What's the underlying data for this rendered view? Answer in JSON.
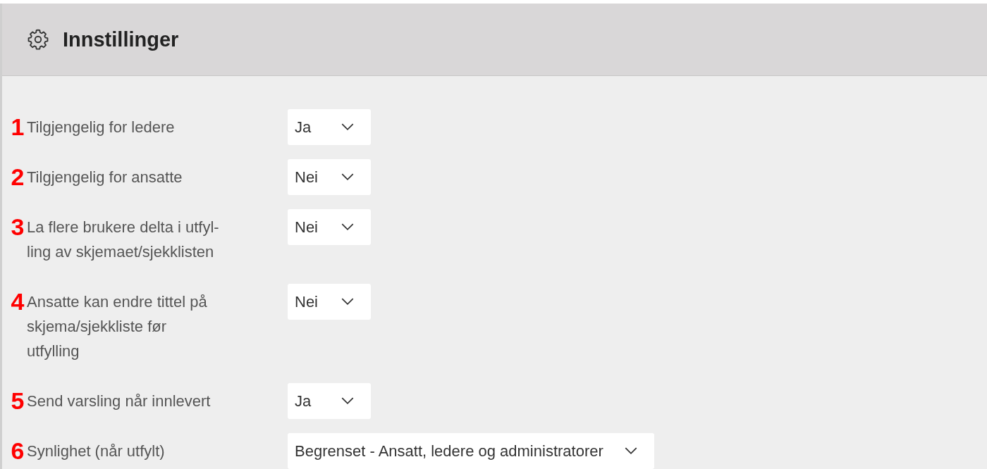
{
  "header": {
    "title": "Innstillinger"
  },
  "settings": [
    {
      "number": "1",
      "label_lines": [
        "Tilgjengelig for ledere"
      ],
      "value": "Ja"
    },
    {
      "number": "2",
      "label_lines": [
        "Tilgjengelig for ansatte"
      ],
      "value": "Nei"
    },
    {
      "number": "3",
      "label_lines": [
        "La flere brukere delta i utfyl-",
        "ling av skjemaet/sjekklisten"
      ],
      "value": "Nei"
    },
    {
      "number": "4",
      "label_lines": [
        "Ansatte kan endre tittel på",
        "skjema/sjekkliste før",
        "utfylling"
      ],
      "value": "Nei"
    },
    {
      "number": "5",
      "label_lines": [
        "Send varsling når innlevert"
      ],
      "value": "Ja"
    },
    {
      "number": "6",
      "label_lines": [
        "Synlighet (når utfylt)"
      ],
      "value": "Begrenset - Ansatt, ledere og administratorer"
    }
  ]
}
